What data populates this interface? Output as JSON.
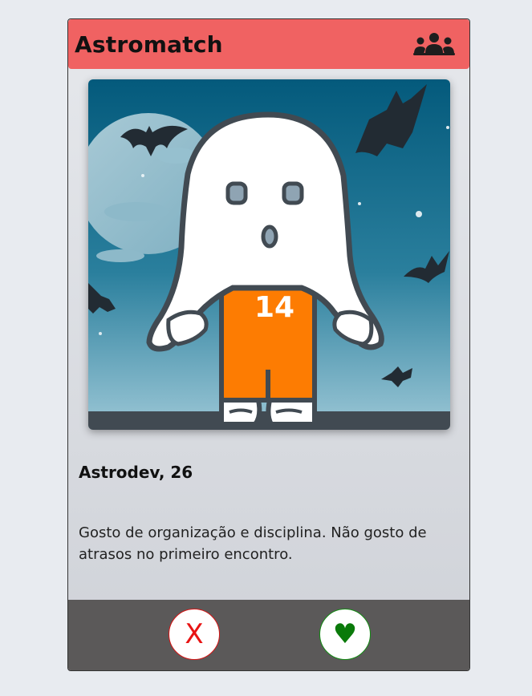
{
  "header": {
    "title": "Astromatch",
    "matches_icon": "group-people-icon"
  },
  "profile": {
    "photo_icon": "ghost-halloween-illustration",
    "jersey_number": "14",
    "name_age": "Astrodev, 26",
    "bio": "Gosto de organização e disciplina. Não gosto de atrasos no primeiro encontro."
  },
  "actions": {
    "reject_label": "X",
    "like_label": "♥"
  },
  "colors": {
    "header": "#f06262",
    "footer": "#5b5959",
    "reject": "#e81414",
    "like": "#0a7a0a"
  }
}
